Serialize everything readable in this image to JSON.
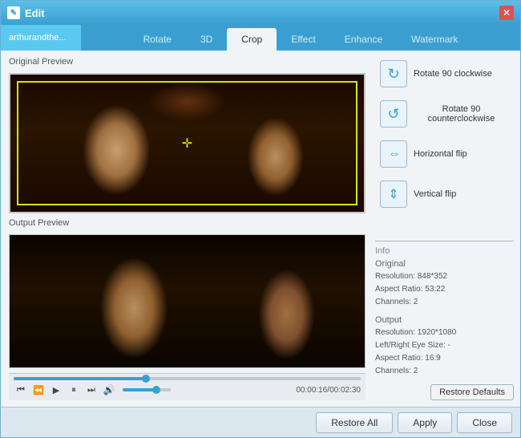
{
  "window": {
    "title": "Edit",
    "close_label": "✕"
  },
  "file_tab": {
    "label": "arthurandthe..."
  },
  "tabs": [
    {
      "id": "rotate",
      "label": "Rotate"
    },
    {
      "id": "3d",
      "label": "3D"
    },
    {
      "id": "crop",
      "label": "Crop"
    },
    {
      "id": "effect",
      "label": "Effect"
    },
    {
      "id": "enhance",
      "label": "Enhance"
    },
    {
      "id": "watermark",
      "label": "Watermark"
    }
  ],
  "active_tab": "crop",
  "original_preview_label": "Original Preview",
  "output_preview_label": "Output Preview",
  "rotate_buttons": [
    {
      "id": "rotate-cw",
      "label": "Rotate 90 clockwise",
      "icon": "↻"
    },
    {
      "id": "rotate-ccw",
      "label": "Rotate 90 counterclockwise",
      "icon": "↺"
    },
    {
      "id": "h-flip",
      "label": "Horizontal flip",
      "icon": "⇔"
    },
    {
      "id": "v-flip",
      "label": "Vertical flip",
      "icon": "⇕"
    }
  ],
  "info": {
    "title": "Info",
    "original_label": "Original",
    "original_resolution": "Resolution: 848*352",
    "original_aspect": "Aspect Ratio: 53:22",
    "original_channels": "Channels: 2",
    "output_label": "Output",
    "output_resolution": "Resolution: 1920*1080",
    "output_lr_size": "Left/Right Eye Size: -",
    "output_aspect": "Aspect Ratio: 16:9",
    "output_channels": "Channels: 2"
  },
  "playback": {
    "time": "00:00:16/00:02:30",
    "progress_pct": 38,
    "volume_pct": 70
  },
  "controls": {
    "skip_back": "⏮",
    "play_back": "⏪",
    "play": "▶",
    "pause": "⏸",
    "skip_fwd": "⏭",
    "volume_icon": "🔊"
  },
  "buttons": {
    "restore_defaults": "Restore Defaults",
    "restore_all": "Restore All",
    "apply": "Apply",
    "close": "Close"
  }
}
